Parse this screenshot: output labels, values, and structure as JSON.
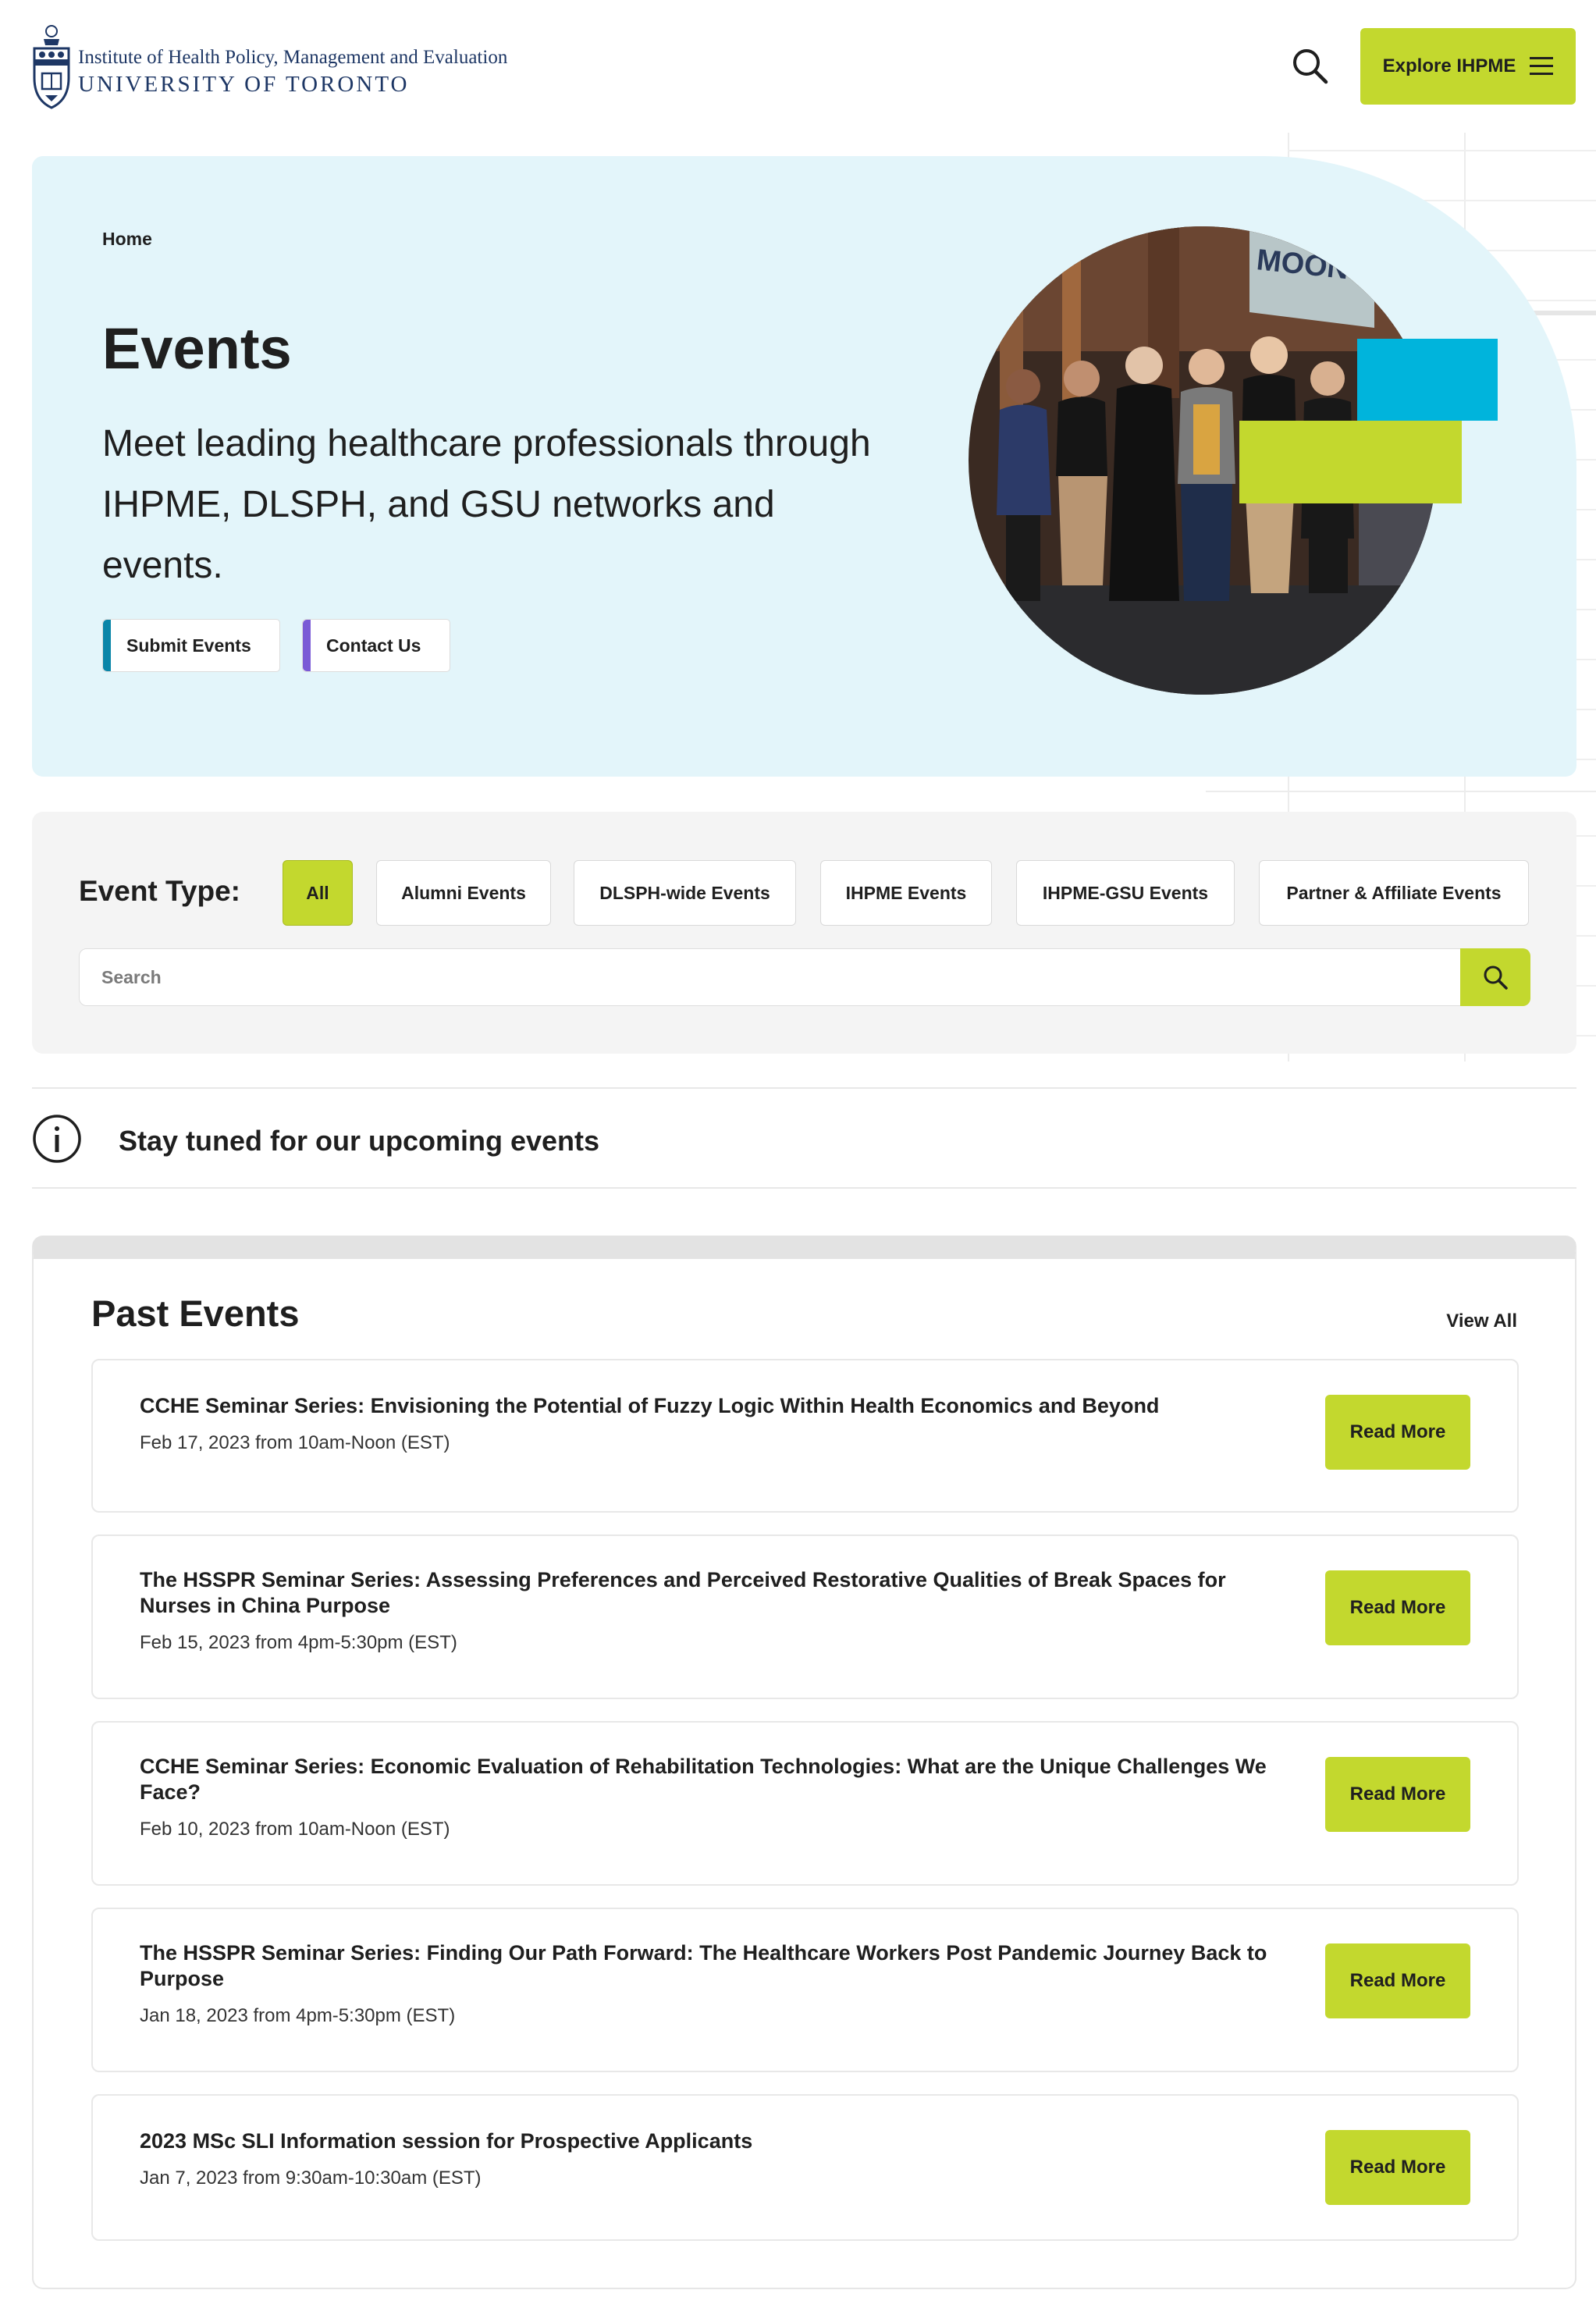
{
  "header": {
    "logo_line1": "Institute of Health Policy, Management and Evaluation",
    "logo_line2": "UNIVERSITY OF TORONTO",
    "explore_label": "Explore IHPME"
  },
  "hero": {
    "breadcrumb": "Home",
    "title": "Events",
    "subtitle": "Meet leading healthcare professionals through IHPME, DLSPH, and GSU networks and events.",
    "buttons": [
      {
        "label": "Submit Events",
        "accent": "#0a85a8"
      },
      {
        "label": "Contact Us",
        "accent": "#7a5ad6"
      }
    ],
    "photo_sign": "MOONSHOT",
    "photo_icon": "group-photo"
  },
  "filter": {
    "label": "Event Type:",
    "chips": [
      "All",
      "Alumni Events",
      "DLSPH-wide Events",
      "IHPME Events",
      "IHPME-GSU Events",
      "Partner & Affiliate Events"
    ],
    "active": "All",
    "search_placeholder": "Search"
  },
  "notice": {
    "text": "Stay tuned for our upcoming events"
  },
  "past_events": {
    "title": "Past Events",
    "view_all": "View All",
    "read_more": "Read More",
    "items": [
      {
        "title": "CCHE Seminar Series: Envisioning the Potential of Fuzzy Logic Within Health Economics and Beyond",
        "date": "Feb 17, 2023 from 10am-Noon (EST)"
      },
      {
        "title": "The HSSPR Seminar Series: Assessing Preferences and Perceived Restorative Qualities of Break Spaces for Nurses in China Purpose",
        "date": "Feb 15, 2023 from 4pm-5:30pm (EST)"
      },
      {
        "title": "CCHE Seminar Series: Economic Evaluation of Rehabilitation Technologies: What are the Unique Challenges We Face?",
        "date": "Feb 10, 2023 from 10am-Noon (EST)"
      },
      {
        "title": "The HSSPR Seminar Series: Finding Our Path Forward: The Healthcare Workers Post Pandemic Journey Back to Purpose",
        "date": "Jan 18, 2023 from 4pm-5:30pm (EST)"
      },
      {
        "title": "2023 MSc SLI Information session for Prospective Applicants",
        "date": "Jan 7, 2023 from 9:30am-10:30am (EST)"
      }
    ]
  },
  "colors": {
    "lime": "#c3d82e",
    "hero_bg": "#e3f5fa",
    "accent_blue": "#00b4dc",
    "brand_navy": "#1e3765"
  }
}
